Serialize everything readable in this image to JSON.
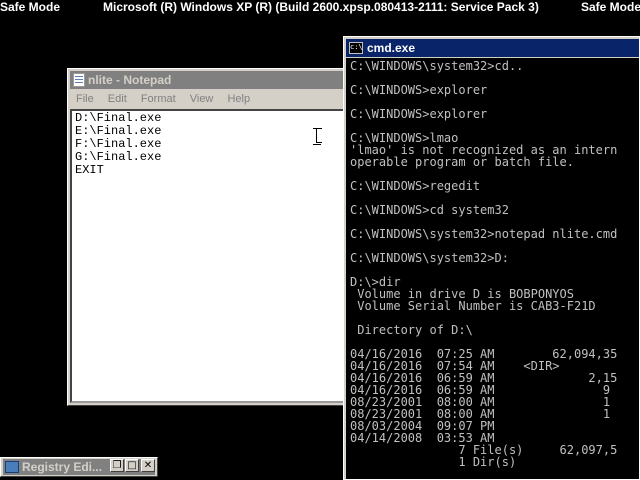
{
  "desktop": {
    "safe_mode_left": "Safe Mode",
    "banner": "Microsoft (R) Windows XP (R) (Build 2600.xpsp.080413-2111: Service Pack 3)",
    "safe_mode_right": "Safe Mode"
  },
  "notepad": {
    "title": "nlite - Notepad",
    "menu": [
      "File",
      "Edit",
      "Format",
      "View",
      "Help"
    ],
    "content": "D:\\Final.exe\nE:\\Final.exe\nF:\\Final.exe\nG:\\Final.exe\nEXIT"
  },
  "cmd": {
    "title": "cmd.exe",
    "output": "C:\\WINDOWS\\system32>cd..\n\nC:\\WINDOWS>explorer\n\nC:\\WINDOWS>explorer\n\nC:\\WINDOWS>lmao\n'lmao' is not recognized as an intern\noperable program or batch file.\n\nC:\\WINDOWS>regedit\n\nC:\\WINDOWS>cd system32\n\nC:\\WINDOWS\\system32>notepad nlite.cmd\n\nC:\\WINDOWS\\system32>D:\n\nD:\\>dir\n Volume in drive D is BOBPONYOS\n Volume Serial Number is CAB3-F21D\n\n Directory of D:\\\n\n04/16/2016  07:25 AM        62,094,35\n04/16/2016  07:54 AM    <DIR>\n04/16/2016  06:59 AM             2,15\n04/16/2016  06:59 AM               9\n08/23/2001  08:00 AM               1\n08/23/2001  08:00 AM               1\n08/03/2004  09:07 PM\n04/14/2008  03:53 AM\n               7 File(s)     62,097,5\n               1 Dir(s)"
  },
  "registry_minimized": {
    "title": "Registry Edi...",
    "restore": "❐",
    "maximize": "□",
    "close": "✕"
  }
}
